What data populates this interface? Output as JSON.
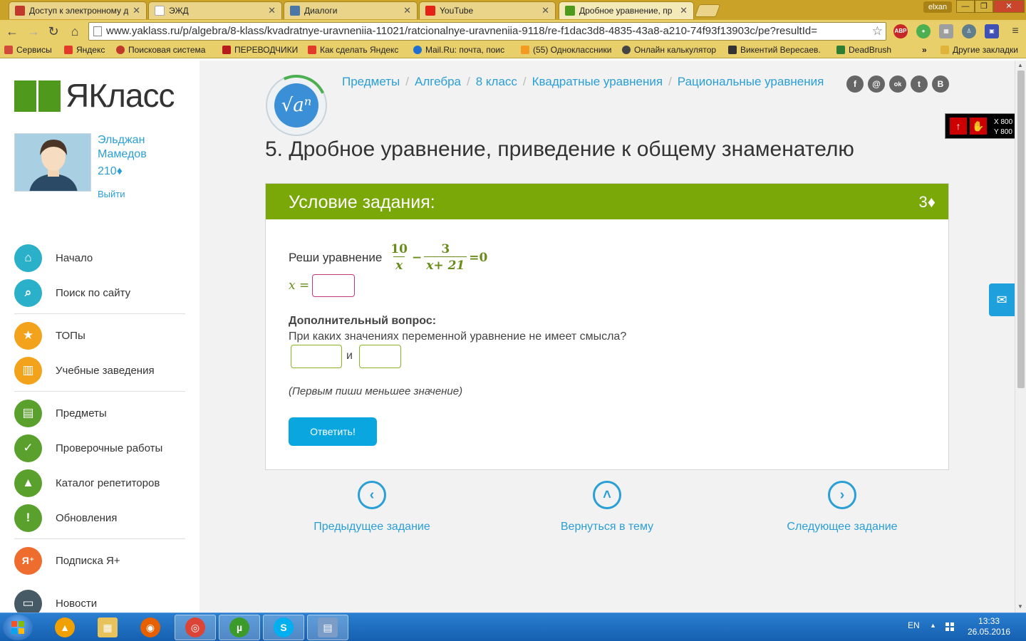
{
  "browser": {
    "tabs": [
      {
        "label": "Доступ к электронному д",
        "favicon_color": "#c0392b"
      },
      {
        "label": "ЭЖД",
        "favicon_color": "#ffffff"
      },
      {
        "label": "Диалоги",
        "favicon_color": "#4a76a8"
      },
      {
        "label": "YouTube",
        "favicon_color": "#e62117"
      },
      {
        "label": "Дробное уравнение, пр",
        "favicon_color": "#4f9a1c"
      }
    ],
    "window_user": "elxan",
    "window_controls": {
      "minimize": "—",
      "maximize": "❐",
      "close": "✕"
    },
    "url": "www.yaklass.ru/p/algebra/8-klass/kvadratnye-uravneniia-11021/ratcionalnye-uravneniia-9118/re-f1dac3d8-4835-43a8-a210-74f93f13903c/pe?resultId=",
    "bookmarks": [
      {
        "label": "Сервисы",
        "color": "#d24a3a"
      },
      {
        "label": "Яндекс",
        "color": "#e23b2a"
      },
      {
        "label": "Поисковая система",
        "color": "#c0392b"
      },
      {
        "label": "ПЕРЕВОДЧИКИ",
        "color": "#b71c1c"
      },
      {
        "label": "Как сделать Яндекс",
        "color": "#e23b2a"
      },
      {
        "label": "Mail.Ru: почта, поис",
        "color": "#1e6fd0"
      },
      {
        "label": "(55) Одноклассники",
        "color": "#f39a22"
      },
      {
        "label": "Онлайн калькулятор",
        "color": "#444444"
      },
      {
        "label": "Викентий Вересаев.",
        "color": "#333333"
      },
      {
        "label": "DeadBrush",
        "color": "#2e7d32"
      }
    ],
    "bookmarks_more": "»",
    "other_bookmarks": "Другие закладки"
  },
  "sidebar": {
    "brand": "ЯКласс",
    "user": {
      "first_name": "Эльджан",
      "last_name": "Мамедов",
      "points": "210♦",
      "logout": "Выйти"
    },
    "menu": [
      {
        "label": "Начало",
        "icon": "home-icon",
        "glyph": "⌂",
        "color": "#2bb0c9"
      },
      {
        "label": "Поиск по сайту",
        "icon": "search-icon",
        "glyph": "⌕",
        "color": "#2bb0c9"
      },
      {
        "label": "ТОПы",
        "icon": "star-icon",
        "glyph": "★",
        "color": "#f3a21b"
      },
      {
        "label": "Учебные заведения",
        "icon": "building-icon",
        "glyph": "▥",
        "color": "#f3a21b"
      },
      {
        "label": "Предметы",
        "icon": "book-icon",
        "glyph": "▤",
        "color": "#5aa02c"
      },
      {
        "label": "Проверочные работы",
        "icon": "check-icon",
        "glyph": "✓",
        "color": "#5aa02c"
      },
      {
        "label": "Каталог репетиторов",
        "icon": "graduation-cap-icon",
        "glyph": "▲",
        "color": "#5aa02c"
      },
      {
        "label": "Обновления",
        "icon": "exclamation-icon",
        "glyph": "!",
        "color": "#5aa02c"
      },
      {
        "label": "Подписка Я+",
        "icon": "ya-plus-icon",
        "glyph": "Я⁺",
        "color": "#ef6c2f"
      },
      {
        "label": "Новости",
        "icon": "chat-icon",
        "glyph": "▭",
        "color": "#455a64"
      }
    ]
  },
  "main": {
    "topic_badge": "√aⁿ",
    "breadcrumbs": [
      "Предметы",
      "Алгебра",
      "8 класс",
      "Квадратные уравнения",
      "Рациональные уравнения"
    ],
    "social": [
      {
        "label": "f",
        "icon": "facebook-icon"
      },
      {
        "label": "@",
        "icon": "mail-ru-icon"
      },
      {
        "label": "ok",
        "icon": "odnoklassniki-icon"
      },
      {
        "label": "t",
        "icon": "twitter-icon"
      },
      {
        "label": "B",
        "icon": "vk-icon"
      }
    ],
    "title": "5. Дробное уравнение, приведение к общему знаменателю",
    "task": {
      "header": "Условие задания:",
      "points": "3♦",
      "prompt": "Реши уравнение",
      "frac1_num": "10",
      "frac1_den": "x",
      "minus": "−",
      "frac2_num": "3",
      "frac2_den": "x+ 21",
      "equals_zero": "=0",
      "x_label": "x =",
      "extra_title": "Дополнительный вопрос:",
      "extra_question": "При каких значениях переменной уравнение не имеет смысла?",
      "and_label": "и",
      "hint": "(Первым пиши меньшее значение)",
      "submit": "Ответить!"
    },
    "nav": {
      "prev": {
        "label": "Предыдущее задание",
        "glyph": "‹"
      },
      "up": {
        "label": "Вернуться в тему",
        "glyph": "˄"
      },
      "next": {
        "label": "Следующее задание",
        "glyph": "›"
      }
    },
    "mail_glyph": "✉"
  },
  "overlay": {
    "x": "X 800",
    "y": "Y 800"
  },
  "taskbar": {
    "apps": [
      {
        "name": "avast-icon",
        "glyph": "▲",
        "color": "#f0a000"
      },
      {
        "name": "file-explorer-icon",
        "glyph": "▦",
        "color": "#e8c25a"
      },
      {
        "name": "firefox-icon",
        "glyph": "◉",
        "color": "#e66000"
      },
      {
        "name": "chrome-icon",
        "glyph": "◎",
        "color": "#db4437"
      },
      {
        "name": "utorrent-icon",
        "glyph": "µ",
        "color": "#3c9a2a"
      },
      {
        "name": "skype-icon",
        "glyph": "S",
        "color": "#00aff0"
      },
      {
        "name": "calculator-icon",
        "glyph": "▤",
        "color": "#7a9cc6"
      }
    ],
    "lang": "EN",
    "tray_arrow": "▲",
    "time": "13:33",
    "date": "26.05.2016"
  }
}
